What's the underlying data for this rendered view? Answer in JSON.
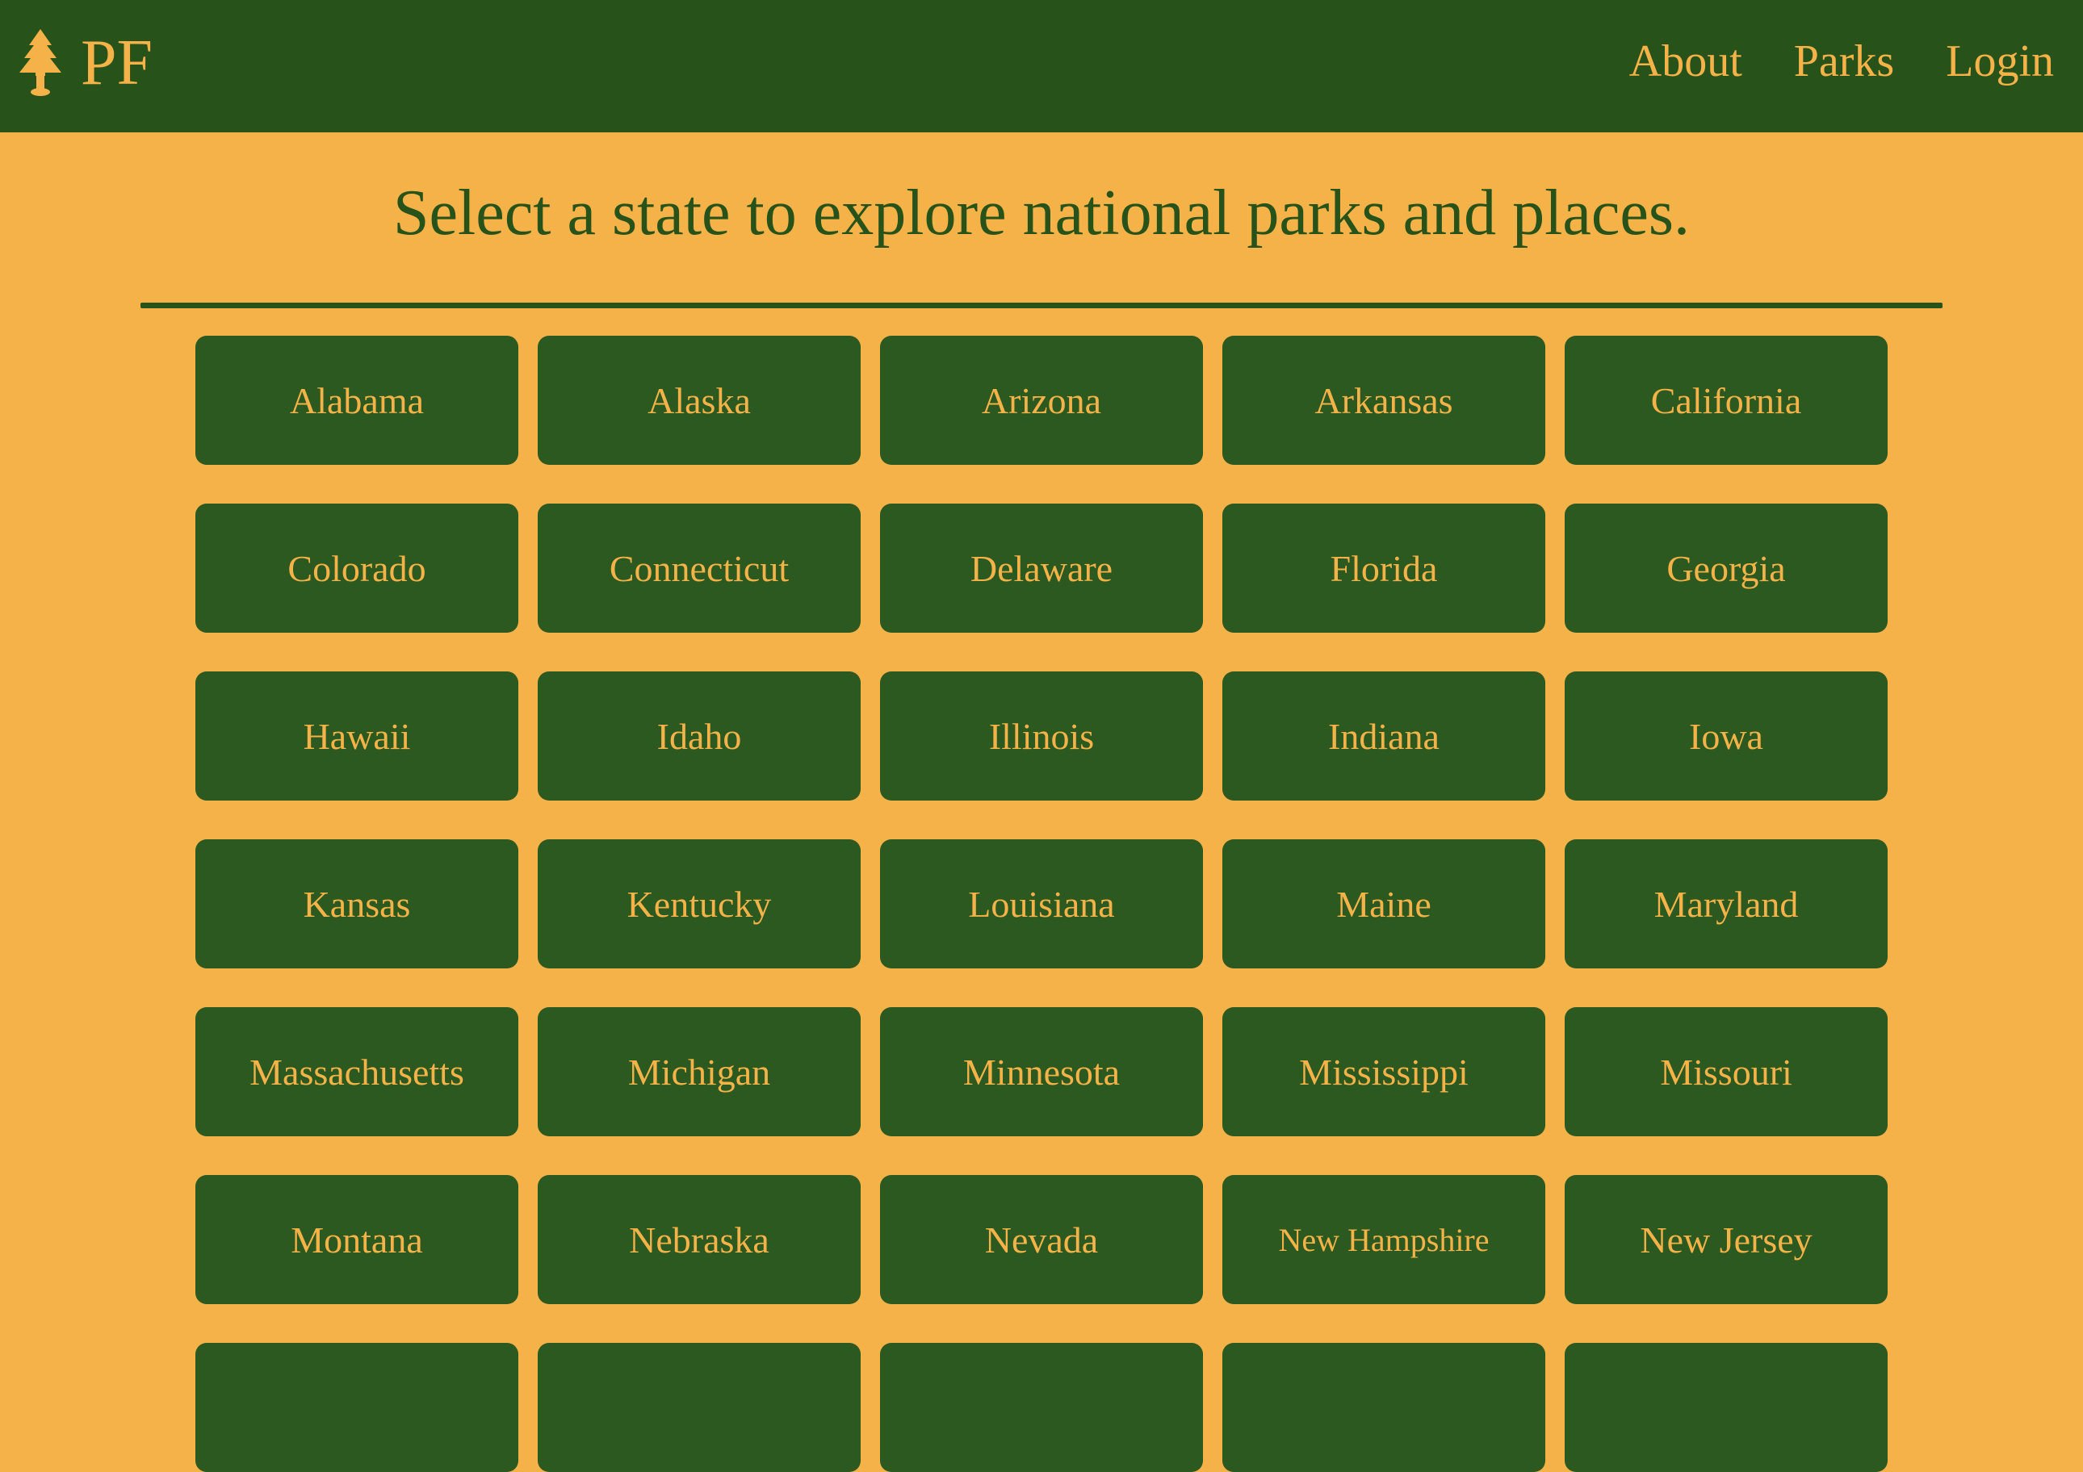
{
  "colors": {
    "navbar_bg": "#275219",
    "page_bg": "#F4B248",
    "accent_text": "#F4B248",
    "button_bg": "#2B591F"
  },
  "header": {
    "logo_icon": "pine-tree-icon",
    "brand": "PF",
    "nav": {
      "about": "About",
      "parks": "Parks",
      "login": "Login"
    }
  },
  "main": {
    "title": "Select a state to explore national parks and places.",
    "states": [
      "Alabama",
      "Alaska",
      "Arizona",
      "Arkansas",
      "California",
      "Colorado",
      "Connecticut",
      "Delaware",
      "Florida",
      "Georgia",
      "Hawaii",
      "Idaho",
      "Illinois",
      "Indiana",
      "Iowa",
      "Kansas",
      "Kentucky",
      "Louisiana",
      "Maine",
      "Maryland",
      "Massachusetts",
      "Michigan",
      "Minnesota",
      "Mississippi",
      "Missouri",
      "Montana",
      "Nebraska",
      "Nevada",
      "New Hampshire",
      "New Jersey"
    ]
  }
}
